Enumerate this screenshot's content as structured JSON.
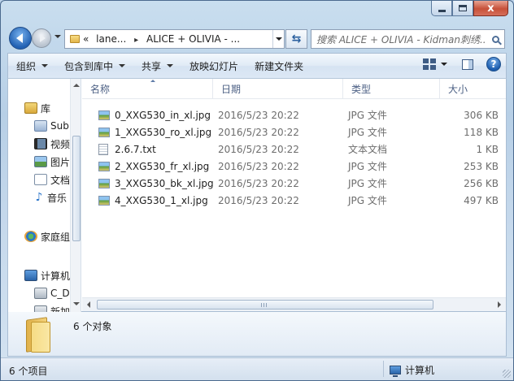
{
  "window": {
    "minimize_glyph": "",
    "close_glyph": "x"
  },
  "nav": {
    "breadcrumb": {
      "overflow": "«",
      "segments": [
        "lane...",
        "ALICE + OLIVIA - ..."
      ]
    },
    "search_placeholder": "搜索 ALICE + OLIVIA - Kidman刺绣..."
  },
  "toolbar": {
    "organize": "组织",
    "include_library": "包含到库中",
    "share": "共享",
    "slideshow": "放映幻灯片",
    "new_folder": "新建文件夹"
  },
  "navpane": {
    "items": [
      {
        "label": "库",
        "icon": "library-icon",
        "indent": false
      },
      {
        "label": "Sub",
        "icon": "video-library-icon",
        "indent": true
      },
      {
        "label": "视频",
        "icon": "film-icon",
        "indent": true
      },
      {
        "label": "图片",
        "icon": "picture-icon",
        "indent": true
      },
      {
        "label": "文档",
        "icon": "document-icon",
        "indent": true
      },
      {
        "label": "音乐",
        "icon": "music-icon",
        "indent": true
      },
      {
        "label": "家庭组",
        "icon": "homegroup-icon",
        "indent": false
      },
      {
        "label": "计算机",
        "icon": "computer-icon",
        "indent": false
      },
      {
        "label": "C_D",
        "icon": "drive-icon",
        "indent": true
      },
      {
        "label": "新加",
        "icon": "drive-icon",
        "indent": true
      }
    ]
  },
  "columns": {
    "name": "名称",
    "date": "日期",
    "type": "类型",
    "size": "大小"
  },
  "files": [
    {
      "name": "0_XXG530_in_xl.jpg",
      "date": "2016/5/23 20:22",
      "type": "JPG 文件",
      "size": "306 KB",
      "kind": "image"
    },
    {
      "name": "1_XXG530_ro_xl.jpg",
      "date": "2016/5/23 20:22",
      "type": "JPG 文件",
      "size": "118 KB",
      "kind": "image"
    },
    {
      "name": "2.6.7.txt",
      "date": "2016/5/23 20:22",
      "type": "文本文档",
      "size": "1 KB",
      "kind": "text"
    },
    {
      "name": "2_XXG530_fr_xl.jpg",
      "date": "2016/5/23 20:22",
      "type": "JPG 文件",
      "size": "253 KB",
      "kind": "image"
    },
    {
      "name": "3_XXG530_bk_xl.jpg",
      "date": "2016/5/23 20:22",
      "type": "JPG 文件",
      "size": "256 KB",
      "kind": "image"
    },
    {
      "name": "4_XXG530_1_xl.jpg",
      "date": "2016/5/23 20:22",
      "type": "JPG 文件",
      "size": "497 KB",
      "kind": "image"
    }
  ],
  "details": {
    "summary": "6 个对象"
  },
  "status": {
    "item_count": "6 个项目",
    "location": "计算机"
  }
}
